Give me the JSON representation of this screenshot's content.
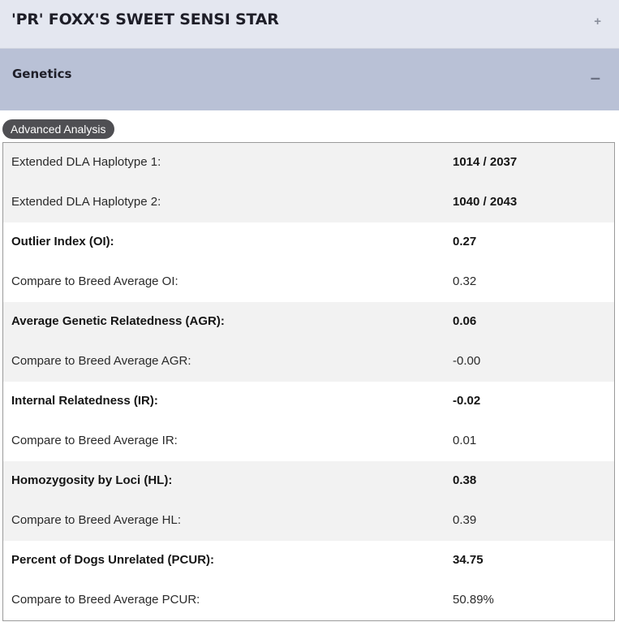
{
  "panel": {
    "title": "'PR' FOXX'S SWEET SENSI STAR",
    "expand_symbol": "+"
  },
  "section": {
    "title": "Genetics",
    "collapse_symbol": "–"
  },
  "badge": {
    "label": "Advanced Analysis"
  },
  "colors": {
    "panel_header_bg": "#e4e7f0",
    "section_header_bg": "#b9c1d6",
    "pill_bg": "#4f4f53",
    "row_shade": "#f2f2f2"
  },
  "icons": {
    "expand": "plus-icon",
    "collapse": "minus-icon"
  },
  "rows": [
    {
      "label": "Extended DLA Haplotype 1:",
      "value": "1014 / 2037",
      "label_bold": false,
      "value_bold": true,
      "shaded": true
    },
    {
      "label": "Extended DLA Haplotype 2:",
      "value": "1040 / 2043",
      "label_bold": false,
      "value_bold": true,
      "shaded": true
    },
    {
      "label": "Outlier Index (OI):",
      "value": "0.27",
      "label_bold": true,
      "value_bold": true,
      "shaded": false
    },
    {
      "label": "Compare to Breed Average OI:",
      "value": "0.32",
      "label_bold": false,
      "value_bold": false,
      "shaded": false
    },
    {
      "label": "Average Genetic Relatedness (AGR):",
      "value": "0.06",
      "label_bold": true,
      "value_bold": true,
      "shaded": true
    },
    {
      "label": "Compare to Breed Average AGR:",
      "value": "-0.00",
      "label_bold": false,
      "value_bold": false,
      "shaded": true
    },
    {
      "label": "Internal Relatedness (IR):",
      "value": "-0.02",
      "label_bold": true,
      "value_bold": true,
      "shaded": false
    },
    {
      "label": "Compare to Breed Average IR:",
      "value": "0.01",
      "label_bold": false,
      "value_bold": false,
      "shaded": false
    },
    {
      "label": "Homozygosity by Loci (HL):",
      "value": "0.38",
      "label_bold": true,
      "value_bold": true,
      "shaded": true
    },
    {
      "label": "Compare to Breed Average HL:",
      "value": "0.39",
      "label_bold": false,
      "value_bold": false,
      "shaded": true
    },
    {
      "label": "Percent of Dogs Unrelated (PCUR):",
      "value": "34.75",
      "label_bold": true,
      "value_bold": true,
      "shaded": false
    },
    {
      "label": "Compare to Breed Average PCUR:",
      "value": "50.89%",
      "label_bold": false,
      "value_bold": false,
      "shaded": false
    }
  ]
}
